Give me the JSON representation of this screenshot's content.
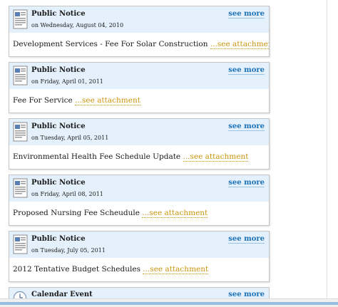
{
  "notices": [
    {
      "title": "Public Notice",
      "date": "on Wednesday, August 04, 2010",
      "see_more": "see more",
      "text": "Development Services - Fee For Solar Construction",
      "attachment": "...see attachment"
    },
    {
      "title": "Public Notice",
      "date": "on Friday, April 01, 2011",
      "see_more": "see more",
      "text": "Fee For Service",
      "attachment": "...see attachment"
    },
    {
      "title": "Public Notice",
      "date": "on Tuesday, April 05, 2011",
      "see_more": "see more",
      "text": "Environmental Health Fee Schedule Update",
      "attachment": "...see attachment"
    },
    {
      "title": "Public Notice",
      "date": "on Friday, April 08, 2011",
      "see_more": "see more",
      "text": "Proposed Nursing Fee Scheudule",
      "attachment": "...see attachment"
    },
    {
      "title": "Public Notice",
      "date": "on Tuesday, July 05, 2011",
      "see_more": "see more",
      "text": "2012 Tentative Budget Schedules",
      "attachment": "...see attachment"
    }
  ],
  "calendar_event": {
    "title": "Calendar Event",
    "see_more": "see more"
  },
  "icons": {
    "notice": "document-icon",
    "event": "calendar-icon"
  },
  "colors": {
    "header_bg": "#e4f0fb",
    "link": "#1c73b8",
    "attachment": "#c8950f"
  }
}
